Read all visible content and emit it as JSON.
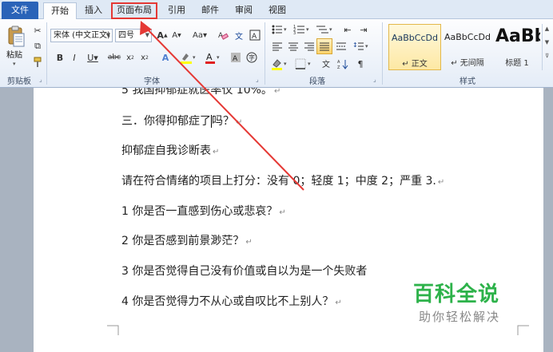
{
  "tabs": [
    {
      "label": "文件"
    },
    {
      "label": "开始"
    },
    {
      "label": "插入"
    },
    {
      "label": "页面布局"
    },
    {
      "label": "引用"
    },
    {
      "label": "邮件"
    },
    {
      "label": "审阅"
    },
    {
      "label": "视图"
    }
  ],
  "ribbon": {
    "clipboard": {
      "paste_label": "粘贴",
      "group_label": "剪贴板"
    },
    "font": {
      "font_name": "宋体 (中文正文)",
      "font_size": "四号",
      "group_label": "字体"
    },
    "paragraph": {
      "group_label": "段落"
    },
    "styles": {
      "group_label": "样式",
      "items": [
        {
          "sample": "AaBbCcDd",
          "name": "↵ 正文"
        },
        {
          "sample": "AaBbCcDd",
          "name": "↵ 无间隔"
        },
        {
          "sample": "AaBb",
          "name": "标题 1"
        }
      ]
    }
  },
  "document": {
    "lines": [
      {
        "text": "5 我国抑郁症就医率仅 10%。"
      },
      {
        "text_before": "三．你得抑郁症了",
        "text_after": "吗？"
      },
      {
        "text": "抑郁症自我诊断表"
      },
      {
        "text": "请在符合情绪的项目上打分：没有 0；轻度 1；中度 2；严重 3."
      },
      {
        "text": "1 你是否一直感到伤心或悲哀？"
      },
      {
        "text": "2 你是否感到前景渺茫？"
      },
      {
        "text": "3 你是否觉得自己没有价值或自以为是一个失败者"
      },
      {
        "text": "4 你是否觉得力不从心或自叹比不上别人？"
      }
    ],
    "para_mark": "↵"
  },
  "watermark": {
    "title": "百科全说",
    "subtitle": "助你轻松解决"
  },
  "colors": {
    "highlight_box": "#e53935",
    "arrow": "#e53935",
    "watermark_green": "#2db24a",
    "file_tab": "#2a63b8"
  }
}
